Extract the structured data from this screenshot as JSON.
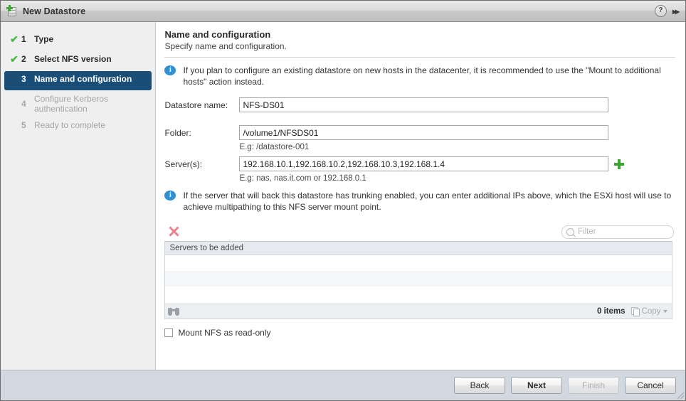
{
  "window": {
    "title": "New Datastore",
    "icon": "datastore-add-icon",
    "help_label": "?",
    "collapse_label": "▸▸"
  },
  "sidebar": {
    "steps": [
      {
        "num": "1",
        "label": "Type",
        "state": "done",
        "check": "✔"
      },
      {
        "num": "2",
        "label": "Select NFS version",
        "state": "done",
        "check": "✔"
      },
      {
        "num": "3",
        "label": "Name and configuration",
        "state": "current",
        "check": ""
      },
      {
        "num": "4",
        "label": "Configure Kerberos authentication",
        "state": "pending",
        "check": ""
      },
      {
        "num": "5",
        "label": "Ready to complete",
        "state": "pending",
        "check": ""
      }
    ]
  },
  "main": {
    "title": "Name and configuration",
    "subtitle": "Specify name and configuration.",
    "info_top": "If you plan to configure an existing datastore on new hosts in the datacenter, it is recommended to use the \"Mount to additional hosts\" action instead.",
    "info_bottom": "If the server that will back this datastore has trunking enabled, you can enter additional IPs above, which the ESXi host will use to achieve multipathing to this NFS server mount point.",
    "fields": {
      "datastore_name_label": "Datastore name:",
      "datastore_name_value": "NFS-DS01",
      "folder_label": "Folder:",
      "folder_value": "/volume1/NFSDS01",
      "folder_hint": "E.g: /datastore-001",
      "servers_label": "Server(s):",
      "servers_value": "192.168.10.1,192.168.10.2,192.168.10.3,192.168.1.4",
      "servers_hint": "E.g: nas, nas.it.com or 192.168.0.1",
      "add_server_icon": "plus-icon"
    },
    "table": {
      "delete_icon": "delete-x-icon",
      "filter_placeholder": "Filter",
      "filter_value": "",
      "columns": [
        "Servers to be added"
      ],
      "rows": [],
      "items_count": "0 items",
      "copy_label": "Copy",
      "search_icon": "binoculars-icon"
    },
    "readonly_checkbox": {
      "label": "Mount NFS as read-only",
      "checked": false
    }
  },
  "footer": {
    "buttons": [
      {
        "label": "Back",
        "state": "enabled"
      },
      {
        "label": "Next",
        "state": "primary"
      },
      {
        "label": "Finish",
        "state": "disabled"
      },
      {
        "label": "Cancel",
        "state": "enabled"
      }
    ]
  },
  "colors": {
    "accent": "#1b4e77",
    "success": "#4db848",
    "info": "#2e8fd4",
    "danger": "#e8828c",
    "footer_bg": "#d2d8e0"
  }
}
